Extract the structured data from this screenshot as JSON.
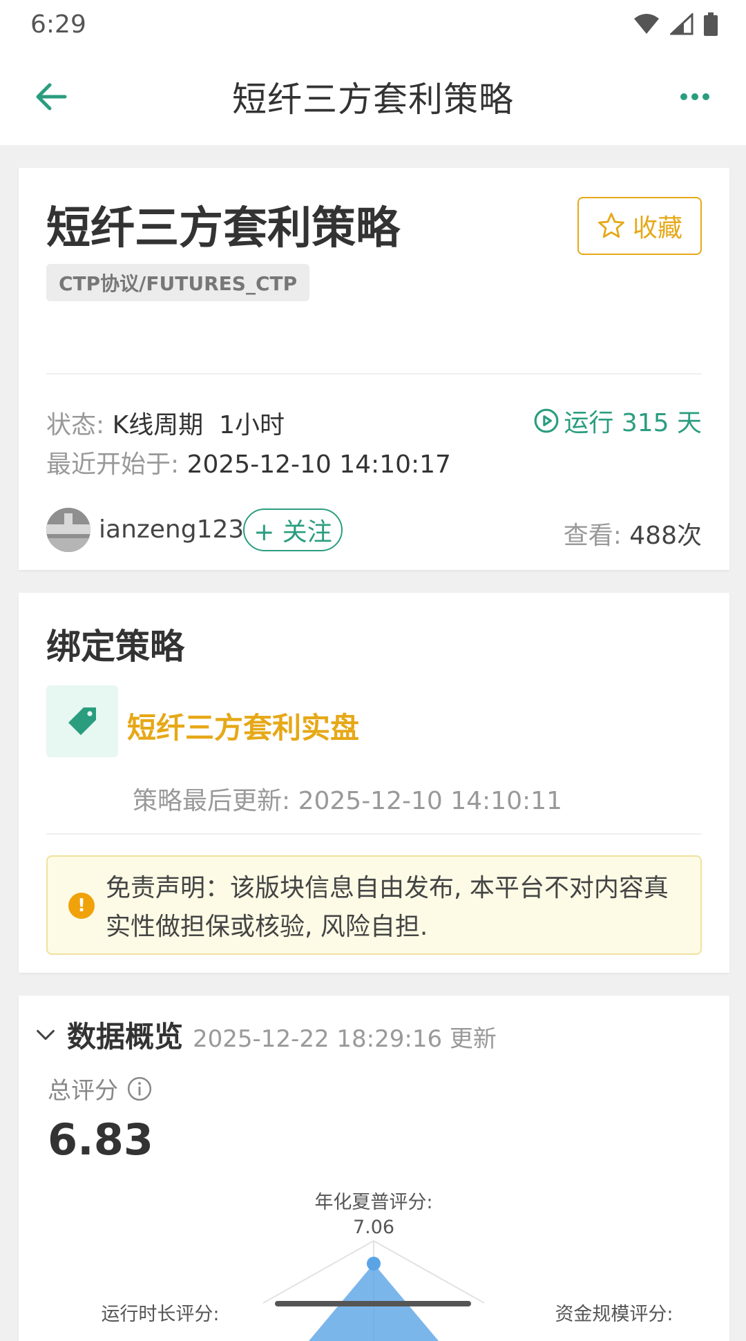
{
  "status_bar": {
    "time": "6:29"
  },
  "app_bar": {
    "title": "短纤三方套利策略"
  },
  "strategy": {
    "name": "短纤三方套利策略",
    "favorite_label": "收藏",
    "protocol_tag": "CTP协议/FUTURES_CTP",
    "status_label": "状态:",
    "status_value": "K线周期  1小时",
    "started_label": "最近开始于:",
    "started_value": "2025-12-10 14:10:17",
    "running_text": "运行 315 天",
    "author": "ianzeng123",
    "follow_label": "+ 关注",
    "views_label": "查看:",
    "views_value": "488次"
  },
  "binding": {
    "section_title": "绑定策略",
    "bound_name": "短纤三方套利实盘",
    "updated_text": "策略最后更新: 2025-12-10 14:10:11",
    "disclaimer": "免责声明：该版块信息自由发布, 本平台不对内容真实性做担保或核验, 风险自担."
  },
  "overview": {
    "title": "数据概览",
    "updated": "2025-12-22 18:29:16 更新",
    "score_label": "总评分",
    "score_value": "6.83",
    "radar": {
      "top_label": "年化夏普评分:",
      "top_value": "7.06",
      "left_label": "运行时长评分:",
      "right_label": "资金规模评分:"
    }
  },
  "colors": {
    "accent_green": "#2a9d7f",
    "accent_orange": "#e6a817",
    "radar_fill": "#5aa4e6"
  }
}
